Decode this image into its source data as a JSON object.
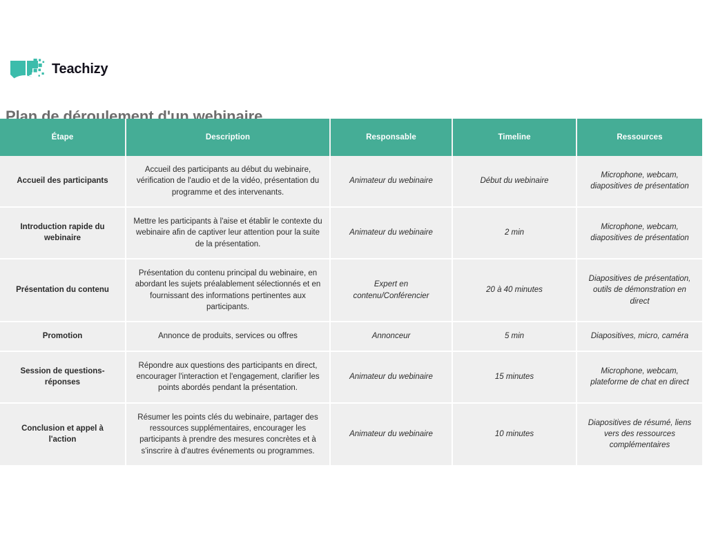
{
  "brand": {
    "name": "Teachizy",
    "logo_icon": "open-book-pixel-icon",
    "accent_color": "#3BBCAB"
  },
  "document": {
    "title": "Plan de déroulement d'un webinaire",
    "title_color": "#6D6D6D"
  },
  "table": {
    "header_bg": "#45AD96",
    "header_text_color": "#FFFFFF",
    "row_bg": "#EFEFEF",
    "columns": [
      {
        "key": "etape",
        "label": "Étape"
      },
      {
        "key": "description",
        "label": "Description"
      },
      {
        "key": "responsable",
        "label": "Responsable"
      },
      {
        "key": "timeline",
        "label": "Timeline"
      },
      {
        "key": "ressources",
        "label": "Ressources"
      }
    ],
    "rows": [
      {
        "etape": "Accueil des participants",
        "description": "Accueil des participants au début du webinaire, vérification de l'audio et de la vidéo, présentation du programme et des intervenants.",
        "responsable": "Animateur du webinaire",
        "timeline": "Début du webinaire",
        "ressources": "Microphone, webcam, diapositives de présentation"
      },
      {
        "etape": "Introduction rapide du webinaire",
        "description": "Mettre les participants à l'aise et établir le contexte du webinaire afin de captiver leur attention pour la suite de la présentation.",
        "responsable": "Animateur du webinaire",
        "timeline": "2 min",
        "ressources": "Microphone, webcam, diapositives de présentation"
      },
      {
        "etape": "Présentation du contenu",
        "description": "Présentation du contenu principal du webinaire, en abordant les sujets préalablement sélectionnés et en fournissant des informations pertinentes aux participants.",
        "responsable": "Expert en contenu/Conférencier",
        "timeline": "20 à 40 minutes",
        "ressources": "Diapositives de présentation, outils de démonstration en direct"
      },
      {
        "etape": "Promotion",
        "description": "Annonce de produits, services ou offres",
        "responsable": "Annonceur",
        "timeline": "5 min",
        "ressources": "Diapositives, micro, caméra"
      },
      {
        "etape": "Session de questions-réponses",
        "description": "Répondre aux questions des participants en direct, encourager l'interaction et l'engagement, clarifier les points abordés pendant la présentation.",
        "responsable": "Animateur du webinaire",
        "timeline": "15 minutes",
        "ressources": "Microphone, webcam, plateforme de chat en direct"
      },
      {
        "etape": "Conclusion et appel à l'action",
        "description": "Résumer les points clés du webinaire, partager des ressources supplémentaires, encourager les participants à prendre des mesures concrètes et à s'inscrire à d'autres événements ou programmes.",
        "responsable": "Animateur du webinaire",
        "timeline": "10 minutes",
        "ressources": "Diapositives de résumé, liens vers des ressources complémentaires"
      }
    ]
  }
}
